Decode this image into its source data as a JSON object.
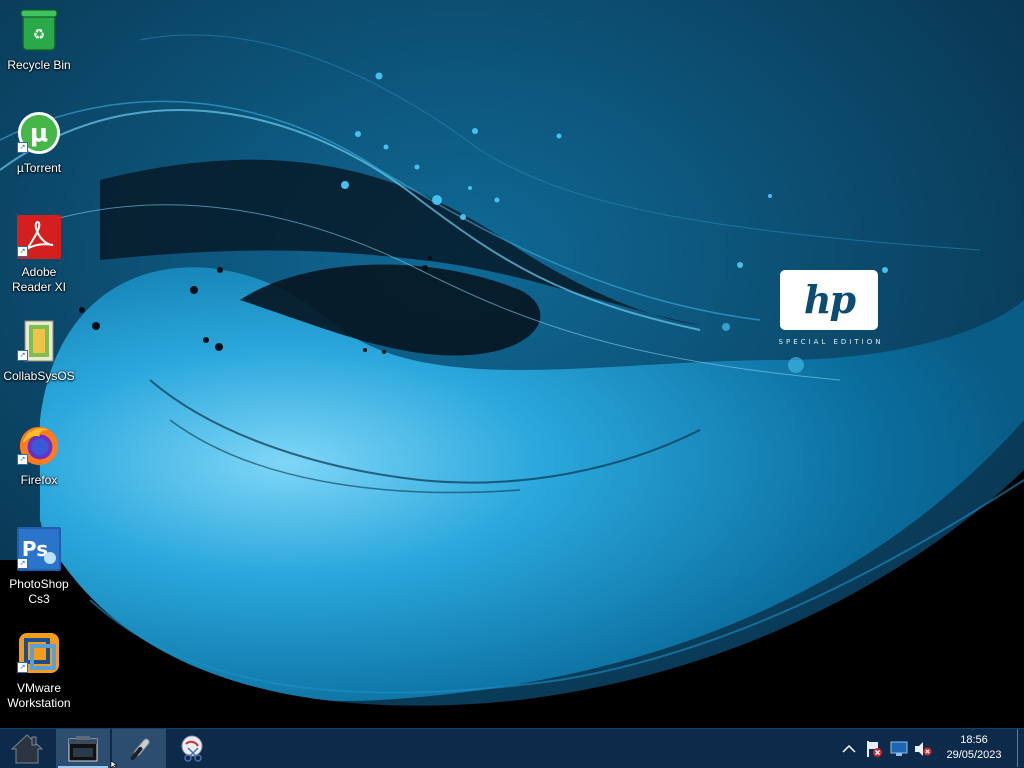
{
  "desktop": {
    "icons": [
      {
        "label": "Recycle Bin",
        "icon": "recycle-bin-icon"
      },
      {
        "label": "µTorrent",
        "icon": "utorrent-icon"
      },
      {
        "label": "Adobe Reader XI",
        "icon": "adobe-reader-icon"
      },
      {
        "label": "CollabSysOS",
        "icon": "collabsysos-icon"
      },
      {
        "label": "Firefox",
        "icon": "firefox-icon"
      },
      {
        "label": "PhotoShop Cs3",
        "icon": "photoshop-icon"
      },
      {
        "label": "VMware Workstation",
        "icon": "vmware-icon"
      }
    ]
  },
  "wallpaper": {
    "logo_text": "hp",
    "tagline": "SPECIAL EDITION",
    "colors": {
      "deep": "#0a2a40",
      "mid": "#0d5f8a",
      "bright": "#2fb2e6",
      "black": "#000000"
    }
  },
  "taskbar": {
    "buttons": [
      {
        "icon": "start-home-icon"
      },
      {
        "icon": "file-explorer-icon"
      },
      {
        "icon": "microphone-icon"
      },
      {
        "icon": "snipping-tool-icon"
      }
    ],
    "tray": {
      "icons": [
        "chevron-up-icon",
        "network-flag-icon",
        "monitor-icon",
        "volume-muted-icon"
      ]
    },
    "clock": {
      "time": "18:56",
      "date": "29/05/2023"
    },
    "colors": {
      "background": "#0e2a4a",
      "active": "#2c4d6e",
      "accent": "#9ec7ee"
    }
  }
}
